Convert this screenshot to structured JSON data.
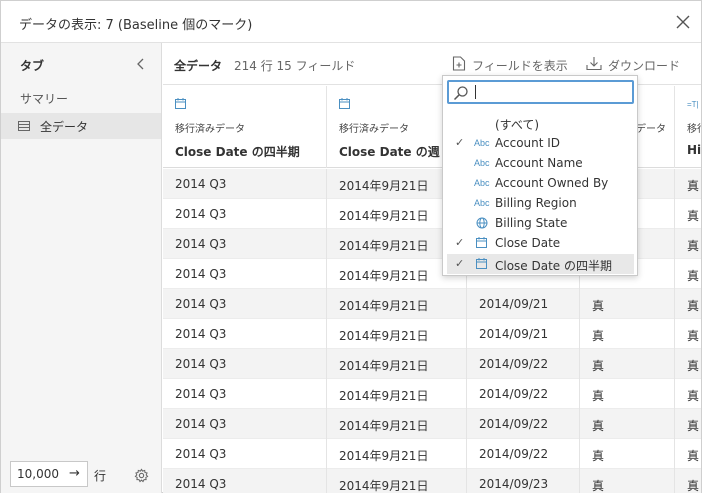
{
  "dialog": {
    "title": "データの表示: 7 (Baseline 個のマーク)"
  },
  "sidebar": {
    "tab_label": "タブ",
    "summary_label": "サマリー",
    "all_data_label": "全データ",
    "row_limit_value": "10,000",
    "row_limit_arrow": "→",
    "row_unit": "行"
  },
  "toolbar": {
    "title": "全データ",
    "meta": "214 行 15 フィールド",
    "show_fields_label": "フィールドを表示",
    "download_label": "ダウンロード"
  },
  "columns": [
    {
      "sub": "移行済みデータ",
      "name": "Close Date の四半期"
    },
    {
      "sub": "移行済みデータ",
      "name": "Close Date の週"
    },
    {
      "sub": "",
      "name": ""
    },
    {
      "sub": "データ",
      "name": ""
    },
    {
      "sub": "移行",
      "name": "Hic"
    }
  ],
  "rows": [
    [
      "2014 Q3",
      "2014年9月21日",
      "",
      "",
      "真"
    ],
    [
      "2014 Q3",
      "2014年9月21日",
      "",
      "",
      "真"
    ],
    [
      "2014 Q3",
      "2014年9月21日",
      "",
      "",
      "真"
    ],
    [
      "2014 Q3",
      "2014年9月21日",
      "",
      "",
      "真"
    ],
    [
      "2014 Q3",
      "2014年9月21日",
      "2014/09/21",
      "真",
      "真"
    ],
    [
      "2014 Q3",
      "2014年9月21日",
      "2014/09/21",
      "真",
      "真"
    ],
    [
      "2014 Q3",
      "2014年9月21日",
      "2014/09/22",
      "真",
      "真"
    ],
    [
      "2014 Q3",
      "2014年9月21日",
      "2014/09/22",
      "真",
      "真"
    ],
    [
      "2014 Q3",
      "2014年9月21日",
      "2014/09/22",
      "真",
      "真"
    ],
    [
      "2014 Q3",
      "2014年9月21日",
      "2014/09/22",
      "真",
      "真"
    ],
    [
      "2014 Q3",
      "2014年9月21日",
      "2014/09/23",
      "真",
      "真"
    ]
  ],
  "field_menu": {
    "search_value": "",
    "items": [
      {
        "label": "(すべて)",
        "checked": false,
        "type": "none"
      },
      {
        "label": "Account ID",
        "checked": true,
        "type": "Abc"
      },
      {
        "label": "Account Name",
        "checked": false,
        "type": "Abc"
      },
      {
        "label": "Account Owned By",
        "checked": false,
        "type": "Abc"
      },
      {
        "label": "Billing Region",
        "checked": false,
        "type": "Abc"
      },
      {
        "label": "Billing State",
        "checked": false,
        "type": "globe"
      },
      {
        "label": "Close Date",
        "checked": true,
        "type": "calendar"
      },
      {
        "label": "Close Date の四半期",
        "checked": true,
        "type": "calendar"
      }
    ],
    "check_glyph": "✓",
    "abc_text": "Abc"
  },
  "colors": {
    "accent": "#5b9bd5",
    "type_icon": "#4a8fc1"
  }
}
